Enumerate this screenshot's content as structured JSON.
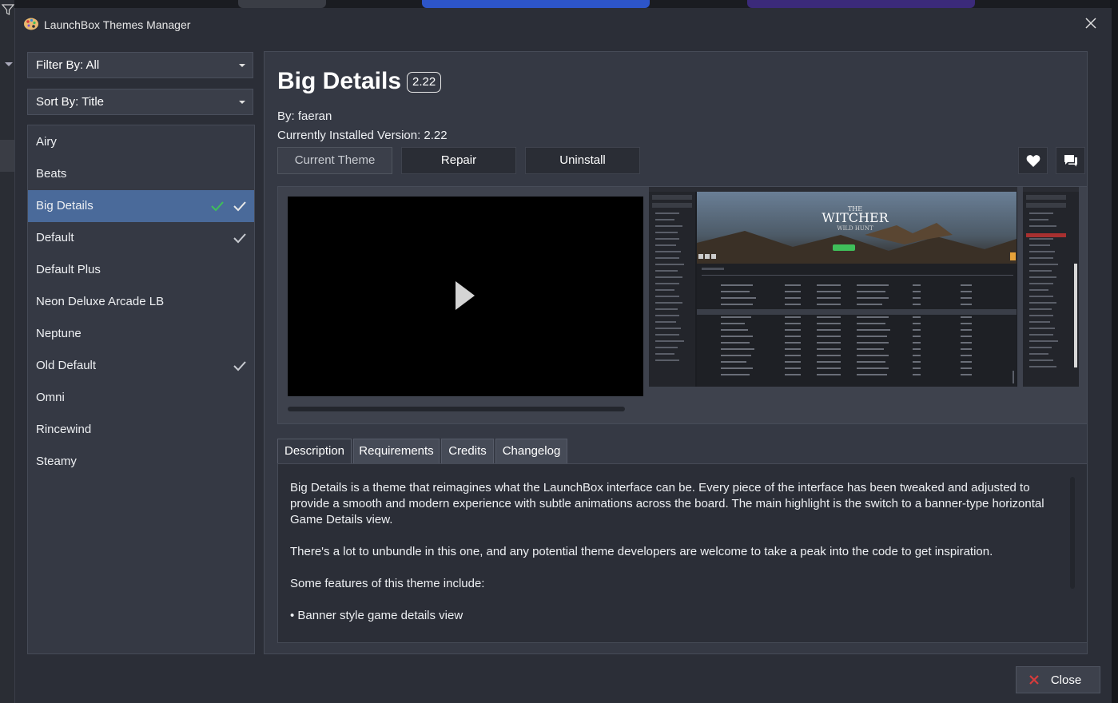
{
  "window": {
    "title": "LaunchBox Themes Manager"
  },
  "filters": {
    "filter_by": "Filter By: All",
    "sort_by": "Sort By: Title"
  },
  "themes": [
    {
      "name": "Airy",
      "installed": false,
      "active": false
    },
    {
      "name": "Beats",
      "installed": false,
      "active": false
    },
    {
      "name": "Big Details",
      "installed": true,
      "active": true
    },
    {
      "name": "Default",
      "installed": true,
      "active": false
    },
    {
      "name": "Default Plus",
      "installed": false,
      "active": false
    },
    {
      "name": "Neon Deluxe Arcade LB",
      "installed": false,
      "active": false
    },
    {
      "name": "Neptune",
      "installed": false,
      "active": false
    },
    {
      "name": "Old Default",
      "installed": true,
      "active": false
    },
    {
      "name": "Omni",
      "installed": false,
      "active": false
    },
    {
      "name": "Rincewind",
      "installed": false,
      "active": false
    },
    {
      "name": "Steamy",
      "installed": false,
      "active": false
    }
  ],
  "detail": {
    "title": "Big Details",
    "version_badge": "2.22",
    "author": "By: faeran",
    "installed_version": "Currently Installed Version: 2.22",
    "buttons": {
      "current_theme": "Current Theme",
      "repair": "Repair",
      "uninstall": "Uninstall"
    },
    "icons": {
      "favorite": "heart-icon",
      "comments": "comment-icon"
    },
    "tabs": [
      "Description",
      "Requirements",
      "Credits",
      "Changelog"
    ],
    "active_tab": "Description",
    "description": [
      "Big Details is a theme that reimagines what the LaunchBox interface can be. Every piece of the interface has been tweaked and adjusted to provide a smooth and modern experience with subtle animations across the board. The main highlight is the switch to a banner-type horizontal Game Details view.",
      "There's a lot to unbundle in this one, and any potential theme developers are welcome to take a peak into the code to get inspiration.",
      "Some features of this theme include:",
      "• Banner style game details view"
    ],
    "screenshot_text": {
      "title_line1": "THE",
      "title_line2": "WITCHER",
      "title_line3": "WILD HUNT"
    }
  },
  "footer": {
    "close_label": "Close"
  },
  "colors": {
    "selected": "#4a6a9a",
    "check_green": "#3fbf5a",
    "accent_red": "#d83b3b"
  }
}
